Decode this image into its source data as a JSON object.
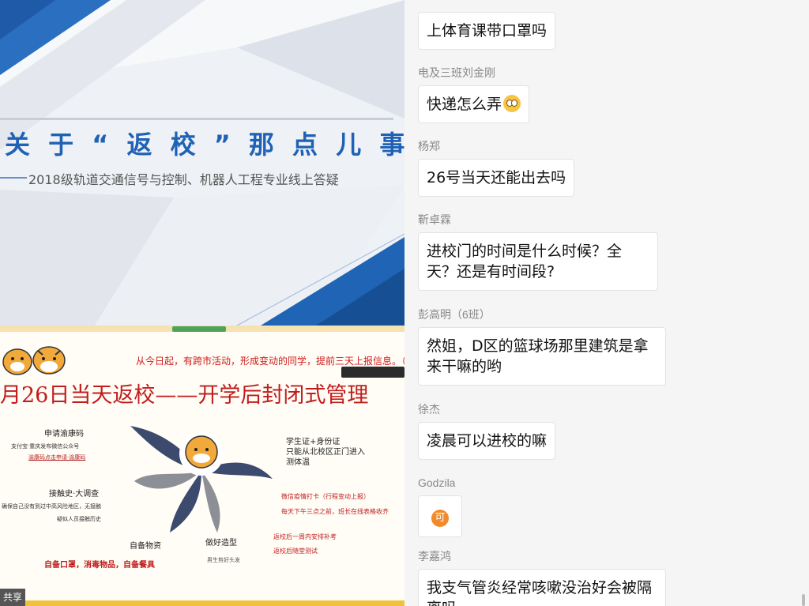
{
  "slides": {
    "slide1": {
      "title": "关 于 “ 返 校 ” 那 点 儿 事",
      "subtitle": "2018级轨道交通信号与控制、机器人工程专业线上答疑"
    },
    "slide2": {
      "notice": "从今日起，有跨市活动，形成变动的同学，提前三天上报信息。（给班长",
      "heading": "月26日当天返校——开学后封闭式管理",
      "items": {
        "apply_health_code": "申请渝康码",
        "apply_detail_1": "支付宝·重庆发布微信公众号",
        "apply_detail_2": "渝康码点击申请·渝康码",
        "contact_history": "接触史·大调查",
        "contact_detail_1": "确保自己没有到过中高风险地区，无接触",
        "contact_detail_2": "疑似人员接触历史",
        "supplies": "自备物资",
        "supplies_detail": "自备口罩，消毒物品，自备餐具",
        "haircut": "做好造型",
        "haircut_detail": "男生剪好头发",
        "id_cards": "学生证+身份证",
        "entrance": "只能从北校区正门进入",
        "temperature": "测体温",
        "checkin": "微信疫情打卡（行程变动上报）",
        "daily_collect": "每天下午三点之前，班长在线表格收齐",
        "makeup_exam": "返校后一周内安排补考",
        "random_test": "返校后随堂测试"
      }
    },
    "share_label": "共享"
  },
  "chat": {
    "messages": [
      {
        "sender": "",
        "text": "上体育课带口罩吗"
      },
      {
        "sender": "电及三班刘金刚",
        "text": "快递怎么弄",
        "emoji": "flushed-face"
      },
      {
        "sender": "杨郑",
        "text": "26号当天还能出去吗"
      },
      {
        "sender": "靳卓霖",
        "text": "进校门的时间是什么时候？全天？还是有时间段?"
      },
      {
        "sender": "彭高明（6班）",
        "text": "然姐，D区的篮球场那里建筑是拿来干嘛的哟"
      },
      {
        "sender": "徐杰",
        "text": "凌晨可以进校的嘛"
      },
      {
        "sender": "Godzila",
        "text": "",
        "emoji": "ke-sticker",
        "emoji_text": "可"
      },
      {
        "sender": "李嘉鸿",
        "text": "我支气管炎经常咳嗽没治好会被隔离吗"
      }
    ]
  },
  "colors": {
    "slide_title_blue": "#1f62b5",
    "slide2_red": "#c01d1d",
    "tiger_orange": "#f2a93b",
    "fan_navy": "#3c4a6e",
    "fan_gray": "#8d8f96"
  }
}
